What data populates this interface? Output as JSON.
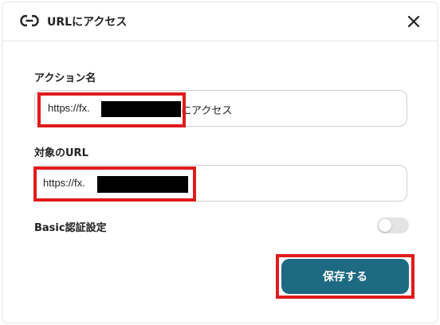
{
  "dialog": {
    "title": "URLにアクセス",
    "icons": {
      "title": "link-icon",
      "close": "close-icon"
    }
  },
  "form": {
    "action_name": {
      "label": "アクション名",
      "value_prefix": "https://fx.",
      "value_suffix": "にアクセス"
    },
    "target_url": {
      "label": "対象のURL",
      "value_prefix": "https://fx."
    },
    "basic_auth": {
      "label": "Basic認証設定",
      "enabled": false
    }
  },
  "actions": {
    "save_label": "保存する"
  },
  "colors": {
    "primary_button": "#1d6a82",
    "highlight": "#e01b1b",
    "redaction": "#000000",
    "toggle_off": "#e4e4e4"
  }
}
